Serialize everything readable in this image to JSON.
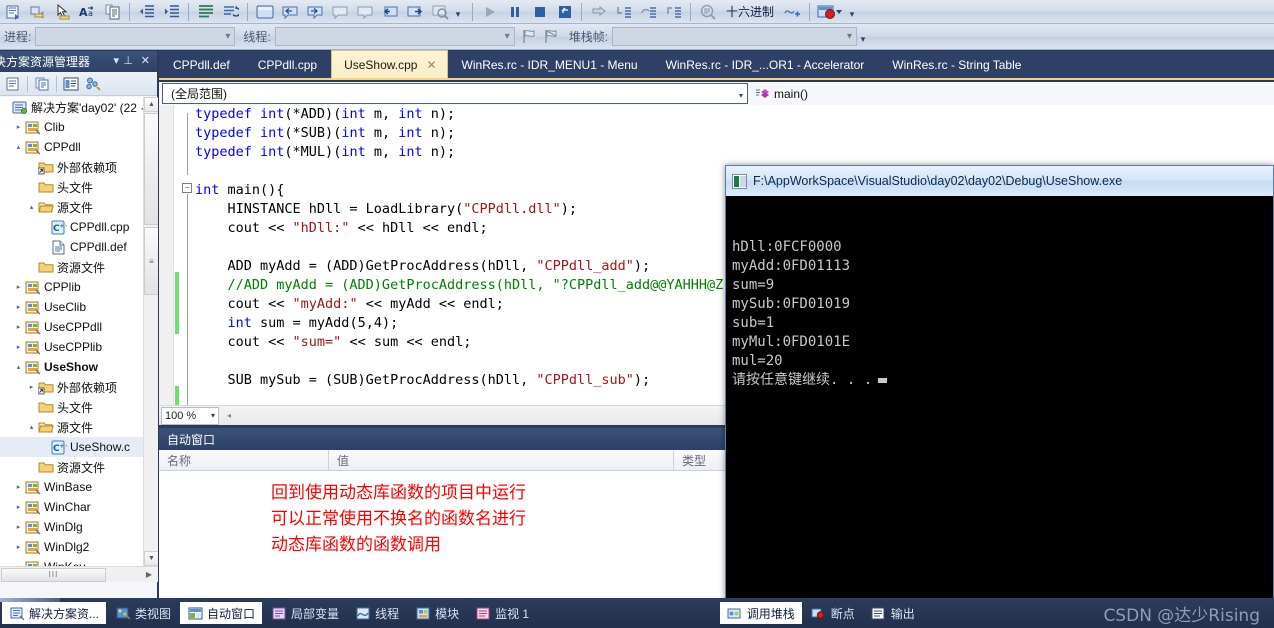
{
  "toolbar_debug": {
    "buttons": [
      {
        "name": "show-next-statement-icon",
        "label": ""
      },
      {
        "name": "step-into-icon",
        "label": ""
      },
      {
        "name": "pointer-select-icon",
        "label": ""
      },
      {
        "name": "toggle-case-icon",
        "label": "A"
      },
      {
        "name": "comment-selection-icon",
        "label": ""
      },
      {
        "name": "decrease-indent-icon",
        "label": ""
      },
      {
        "name": "increase-indent-icon",
        "label": ""
      },
      {
        "name": "format-document-icon",
        "label": ""
      },
      {
        "name": "undo-navigation-icon",
        "label": ""
      },
      {
        "name": "new-window-icon",
        "label": ""
      },
      {
        "name": "navigate-backward-icon",
        "label": ""
      },
      {
        "name": "navigate-forward-icon",
        "label": ""
      },
      {
        "name": "previous-bookmark-icon",
        "label": ""
      },
      {
        "name": "next-bookmark-icon",
        "label": ""
      },
      {
        "name": "toggle-all-bookmarks-icon",
        "label": ""
      },
      {
        "name": "clear-bookmarks-icon",
        "label": ""
      },
      {
        "name": "find-symbol-icon",
        "label": ""
      }
    ],
    "run_buttons": [
      {
        "name": "continue-icon"
      },
      {
        "name": "break-all-icon"
      },
      {
        "name": "stop-debugging-icon"
      },
      {
        "name": "restart-icon"
      },
      {
        "name": "show-next-statement-btn-icon"
      },
      {
        "name": "step-into-btn-icon"
      },
      {
        "name": "step-over-btn-icon"
      },
      {
        "name": "step-out-btn-icon"
      },
      {
        "name": "disassembly-icon"
      }
    ],
    "hex_label": "十六进制",
    "overflow_glyph": "▾"
  },
  "toolbar_location": {
    "process_label": "进程:",
    "process_value": "",
    "thread_label": "线程:",
    "thread_value": "",
    "stackframe_label": "堆栈帧:",
    "stackframe_value": "",
    "caret": "▾"
  },
  "solution_explorer": {
    "title": "决方案资源管理器",
    "dropdown_glyph": "▾",
    "pin_glyph": "⊥",
    "close_glyph": "✕",
    "toolbar_icons": [
      {
        "name": "properties-window-icon"
      },
      {
        "name": "show-all-files-icon"
      },
      {
        "name": "view-code-icon"
      },
      {
        "name": "class-view-icon"
      }
    ],
    "tree": [
      {
        "label": "解决方案'day02' (22 ·",
        "icon": "solution-icon",
        "indent": 0,
        "expander": "",
        "bold": false
      },
      {
        "label": "Clib",
        "icon": "project-icon",
        "indent": 1,
        "expander": "▸",
        "bold": false
      },
      {
        "label": "CPPdll",
        "icon": "project-icon",
        "indent": 1,
        "expander": "▴",
        "bold": false
      },
      {
        "label": "外部依赖项",
        "icon": "folder-deps-icon",
        "indent": 2,
        "expander": "",
        "bold": false
      },
      {
        "label": "头文件",
        "icon": "folder-icon",
        "indent": 2,
        "expander": "",
        "bold": false
      },
      {
        "label": "源文件",
        "icon": "folder-open-icon",
        "indent": 2,
        "expander": "▴",
        "bold": false
      },
      {
        "label": "CPPdll.cpp",
        "icon": "cpp-file-icon",
        "indent": 3,
        "expander": "",
        "bold": false
      },
      {
        "label": "CPPdll.def",
        "icon": "def-file-icon",
        "indent": 3,
        "expander": "",
        "bold": false
      },
      {
        "label": "资源文件",
        "icon": "folder-icon",
        "indent": 2,
        "expander": "",
        "bold": false
      },
      {
        "label": "CPPlib",
        "icon": "project-icon",
        "indent": 1,
        "expander": "▸",
        "bold": false
      },
      {
        "label": "UseClib",
        "icon": "project-icon",
        "indent": 1,
        "expander": "▸",
        "bold": false
      },
      {
        "label": "UseCPPdll",
        "icon": "project-icon",
        "indent": 1,
        "expander": "▸",
        "bold": false
      },
      {
        "label": "UseCPPlib",
        "icon": "project-icon",
        "indent": 1,
        "expander": "▸",
        "bold": false
      },
      {
        "label": "UseShow",
        "icon": "project-icon",
        "indent": 1,
        "expander": "▴",
        "bold": true
      },
      {
        "label": "外部依赖项",
        "icon": "folder-deps-icon",
        "indent": 2,
        "expander": "▸",
        "bold": false
      },
      {
        "label": "头文件",
        "icon": "folder-icon",
        "indent": 2,
        "expander": "",
        "bold": false
      },
      {
        "label": "源文件",
        "icon": "folder-open-icon",
        "indent": 2,
        "expander": "▴",
        "bold": false
      },
      {
        "label": "UseShow.c",
        "icon": "cpp-file-icon",
        "indent": 3,
        "expander": "",
        "bold": false,
        "selected": true
      },
      {
        "label": "资源文件",
        "icon": "folder-icon",
        "indent": 2,
        "expander": "",
        "bold": false
      },
      {
        "label": "WinBase",
        "icon": "project-icon",
        "indent": 1,
        "expander": "▸",
        "bold": false
      },
      {
        "label": "WinChar",
        "icon": "project-icon",
        "indent": 1,
        "expander": "▸",
        "bold": false
      },
      {
        "label": "WinDlg",
        "icon": "project-icon",
        "indent": 1,
        "expander": "▸",
        "bold": false
      },
      {
        "label": "WinDlg2",
        "icon": "project-icon",
        "indent": 1,
        "expander": "▸",
        "bold": false
      },
      {
        "label": "WinKey",
        "icon": "project-icon",
        "indent": 1,
        "expander": "▸",
        "bold": false
      }
    ],
    "hscroll_grip": "III",
    "hscroll_right": "▶"
  },
  "tabs": [
    {
      "label": "CPPdll.def",
      "active": false
    },
    {
      "label": "CPPdll.cpp",
      "active": false
    },
    {
      "label": "UseShow.cpp",
      "active": true,
      "close": "✕"
    },
    {
      "label": "WinRes.rc - IDR_MENU1 - Menu",
      "active": false
    },
    {
      "label": "WinRes.rc - IDR_...OR1 - Accelerator",
      "active": false
    },
    {
      "label": "WinRes.rc - String Table",
      "active": false
    }
  ],
  "navbar": {
    "scope_value": "(全局范围)",
    "member_value": "main()",
    "caret": "▾"
  },
  "editor": {
    "zoom_level": "100 %",
    "zoom_caret": "▾",
    "hscroll_left_glyph": "◂",
    "fold_collapse_glyph": "−",
    "lines": [
      {
        "tokens": [
          {
            "t": "typedef ",
            "c": "k"
          },
          {
            "t": "int",
            "c": "k"
          },
          {
            "t": "(*ADD)(",
            "c": ""
          },
          {
            "t": "int",
            "c": "k"
          },
          {
            "t": " m, ",
            "c": ""
          },
          {
            "t": "int",
            "c": "k"
          },
          {
            "t": " n);",
            "c": ""
          }
        ]
      },
      {
        "tokens": [
          {
            "t": "typedef ",
            "c": "k"
          },
          {
            "t": "int",
            "c": "k"
          },
          {
            "t": "(*SUB)(",
            "c": ""
          },
          {
            "t": "int",
            "c": "k"
          },
          {
            "t": " m, ",
            "c": ""
          },
          {
            "t": "int",
            "c": "k"
          },
          {
            "t": " n);",
            "c": ""
          }
        ]
      },
      {
        "tokens": [
          {
            "t": "typedef ",
            "c": "k"
          },
          {
            "t": "int",
            "c": "k"
          },
          {
            "t": "(*MUL)(",
            "c": ""
          },
          {
            "t": "int",
            "c": "k"
          },
          {
            "t": " m, ",
            "c": ""
          },
          {
            "t": "int",
            "c": "k"
          },
          {
            "t": " n);",
            "c": ""
          }
        ]
      },
      {
        "tokens": []
      },
      {
        "tokens": [
          {
            "t": "int",
            "c": "k"
          },
          {
            "t": " main(){",
            "c": ""
          }
        ]
      },
      {
        "tokens": [
          {
            "t": "    HINSTANCE hDll = LoadLibrary(",
            "c": ""
          },
          {
            "t": "\"CPPdll.dll\"",
            "c": "s"
          },
          {
            "t": ");",
            "c": ""
          }
        ]
      },
      {
        "tokens": [
          {
            "t": "    cout << ",
            "c": ""
          },
          {
            "t": "\"hDll:\"",
            "c": "s"
          },
          {
            "t": " << hDll << endl;",
            "c": ""
          }
        ]
      },
      {
        "tokens": []
      },
      {
        "tokens": [
          {
            "t": "    ADD myAdd = (ADD)GetProcAddress(hDll, ",
            "c": ""
          },
          {
            "t": "\"CPPdll_add\"",
            "c": "s"
          },
          {
            "t": ");",
            "c": ""
          }
        ]
      },
      {
        "tokens": [
          {
            "t": "    //ADD myAdd = (ADD)GetProcAddress(hDll, \"?CPPdll_add@@YAHHH@Z\"",
            "c": "cmt"
          }
        ]
      },
      {
        "tokens": [
          {
            "t": "    cout << ",
            "c": ""
          },
          {
            "t": "\"myAdd:\"",
            "c": "s"
          },
          {
            "t": " << myAdd << endl;",
            "c": ""
          }
        ]
      },
      {
        "tokens": [
          {
            "t": "    ",
            "c": ""
          },
          {
            "t": "int",
            "c": "k"
          },
          {
            "t": " sum = myAdd(5,4);",
            "c": ""
          }
        ]
      },
      {
        "tokens": [
          {
            "t": "    cout << ",
            "c": ""
          },
          {
            "t": "\"sum=\"",
            "c": "s"
          },
          {
            "t": " << sum << endl;",
            "c": ""
          }
        ]
      },
      {
        "tokens": []
      },
      {
        "tokens": [
          {
            "t": "    SUB mySub = (SUB)GetProcAddress(hDll, ",
            "c": ""
          },
          {
            "t": "\"CPPdll_sub\"",
            "c": "s"
          },
          {
            "t": ");",
            "c": ""
          }
        ]
      }
    ]
  },
  "autos": {
    "title": "自动窗口",
    "dropdown_glyph": "▾",
    "pin_glyph": "⊥",
    "columns": [
      "名称",
      "值",
      "类型"
    ],
    "annotation_lines": [
      "回到使用动态库函数的项目中运行",
      "可以正常使用不换名的函数名进行",
      "动态库函数的函数调用"
    ],
    "annotation_color": "#ff0000"
  },
  "console": {
    "title": "F:\\AppWorkSpace\\VisualStudio\\day02\\day02\\Debug\\UseShow.exe",
    "output_lines": [
      "hDll:0FCF0000",
      "myAdd:0FD01113",
      "sum=9",
      "mySub:0FD01019",
      "sub=1",
      "myMul:0FD0101E",
      "mul=20",
      "请按任意键继续. . ."
    ]
  },
  "bottom_tabs_left": [
    {
      "label": "解决方案资...",
      "icon": "solution-explorer-icon",
      "active": true
    },
    {
      "label": "类视图",
      "icon": "class-view-icon",
      "active": false
    },
    {
      "label": "自动窗口",
      "icon": "autos-icon",
      "active": true
    },
    {
      "label": "局部变量",
      "icon": "locals-icon",
      "active": false
    },
    {
      "label": "线程",
      "icon": "threads-icon",
      "active": false
    },
    {
      "label": "模块",
      "icon": "modules-icon",
      "active": false
    },
    {
      "label": "监视 1",
      "icon": "watch-icon",
      "active": false
    }
  ],
  "bottom_tabs_right": [
    {
      "label": "调用堆栈",
      "icon": "callstack-icon",
      "active": true
    },
    {
      "label": "断点",
      "icon": "breakpoints-icon",
      "active": false
    },
    {
      "label": "输出",
      "icon": "output-icon",
      "active": false
    }
  ],
  "watermark": "CSDN @达少Rising",
  "colors": {
    "chrome_dark": "#2e4066",
    "tab_active": "#fdf3d6",
    "accent_gold": "#f0d38d",
    "annotation_red": "#ff0000",
    "keyword_blue": "#0000ff",
    "string_red": "#a31515",
    "comment_green": "#008000"
  }
}
